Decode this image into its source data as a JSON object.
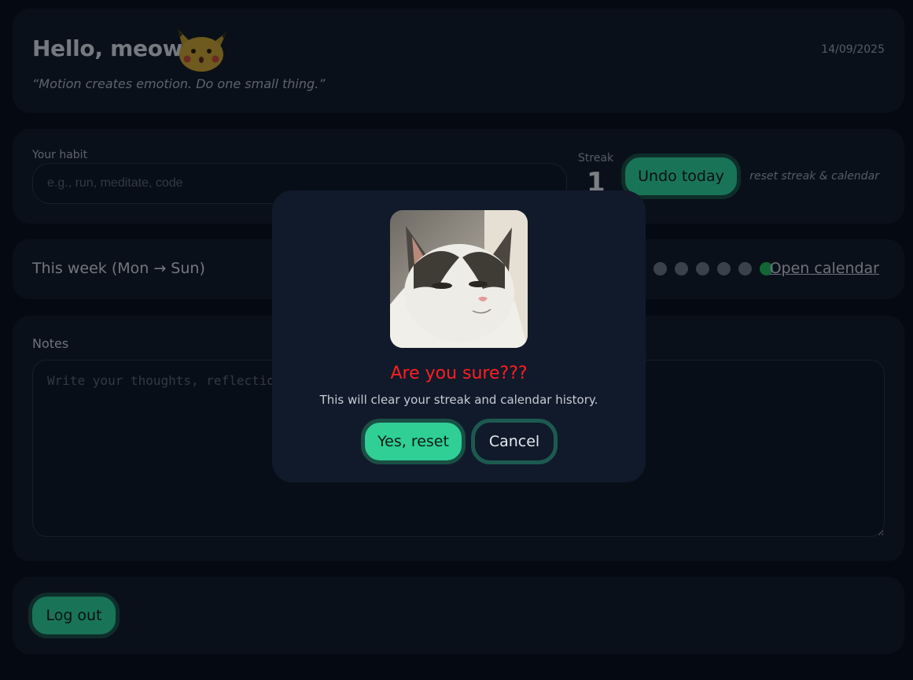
{
  "header": {
    "greeting": "Hello, meow",
    "date": "14/09/2025",
    "quote": "“Motion creates emotion. Do one small thing.”",
    "avatar_icon": "surprised-pikachu-icon"
  },
  "habit": {
    "label": "Your habit",
    "placeholder": "e.g., run, meditate, code",
    "streak_label": "Streak",
    "streak_value": "1",
    "undo_label": "Undo today",
    "reset_label": "reset streak & calendar"
  },
  "week": {
    "title": "This week (Mon → Sun)",
    "days_done": [
      false,
      false,
      false,
      false,
      false,
      false,
      true
    ],
    "open_calendar_label": "Open calendar",
    "colors": {
      "done": "#22b45a",
      "pending": "#6b7380"
    }
  },
  "notes": {
    "label": "Notes",
    "placeholder": "Write your thoughts, reflections..."
  },
  "footer": {
    "logout_label": "Log out"
  },
  "modal": {
    "title": "Are you sure???",
    "message": "This will clear your streak and calendar history.",
    "confirm_label": "Yes, reset",
    "cancel_label": "Cancel",
    "image": "cat-photo",
    "colors": {
      "title": "#ff1f1f",
      "accent": "#2fcf96"
    }
  }
}
